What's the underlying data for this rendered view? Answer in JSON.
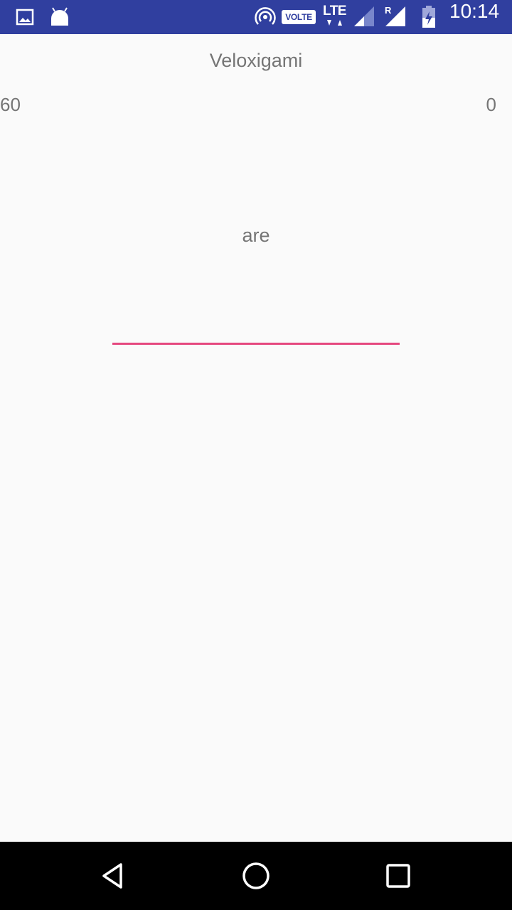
{
  "status_bar": {
    "time": "10:14",
    "network_badge": "VOLTE",
    "network_type": "LTE",
    "roaming_indicator": "R",
    "icons": [
      "gallery-icon",
      "android-icon",
      "hotspot-icon",
      "signal-icon",
      "roaming-signal-icon",
      "battery-charging-icon"
    ],
    "background_color": "#303f9f"
  },
  "app": {
    "title": "Veloxigami"
  },
  "game": {
    "left_counter": "60",
    "right_counter": "0",
    "current_word": "are",
    "answer_value": "",
    "accent_color": "#e5487f"
  },
  "nav_bar": {
    "buttons": [
      "back-icon",
      "home-icon",
      "recents-icon"
    ]
  }
}
